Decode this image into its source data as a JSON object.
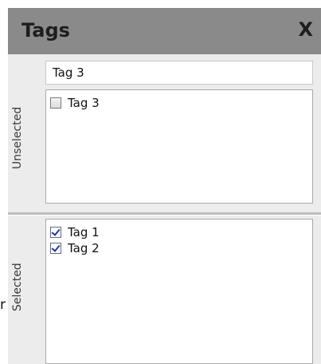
{
  "stray_text": "r",
  "panel": {
    "title": "Tags",
    "close_label": "X"
  },
  "unselected": {
    "label": "Unselected",
    "search_value": "Tag 3",
    "items": [
      {
        "label": "Tag 3",
        "checked": false
      }
    ]
  },
  "selected": {
    "label": "Selected",
    "items": [
      {
        "label": "Tag 1",
        "checked": true
      },
      {
        "label": "Tag 2",
        "checked": true
      }
    ]
  }
}
